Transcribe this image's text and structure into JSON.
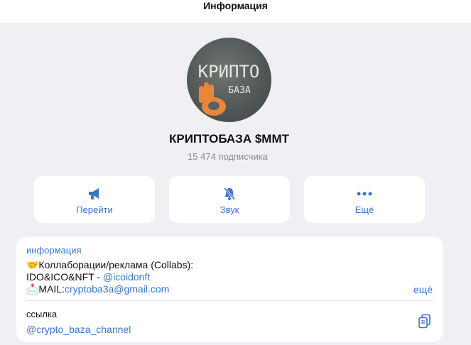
{
  "window": {
    "title": "Информация"
  },
  "channel": {
    "avatar_text_top": "КРИПТО",
    "avatar_text_bottom": "БАЗА",
    "name": "КРИПТОБАЗА $MMT",
    "subscribers": "15 474 подписчика"
  },
  "actions": [
    {
      "label": "Перейти",
      "icon": "megaphone-icon"
    },
    {
      "label": "Звук",
      "icon": "bell-muted-icon"
    },
    {
      "label": "Ещё",
      "icon": "more-dots-icon"
    }
  ],
  "info": {
    "section_title": "информация",
    "line1": "🤝Коллаборации/реклама (Collabs):",
    "line2_prefix": "IDO&ICO&NFT - ",
    "line2_link": "@icoidonft",
    "line3_prefix": "📩MAIL:",
    "line3_link": "cryptoba3a@gmail.com",
    "more_label": "ещё",
    "link_label": "ссылка",
    "link_value": "@crypto_baza_channel"
  },
  "colors": {
    "accent": "#3a74c6",
    "background": "#f0f0f4",
    "card": "#ffffff"
  }
}
